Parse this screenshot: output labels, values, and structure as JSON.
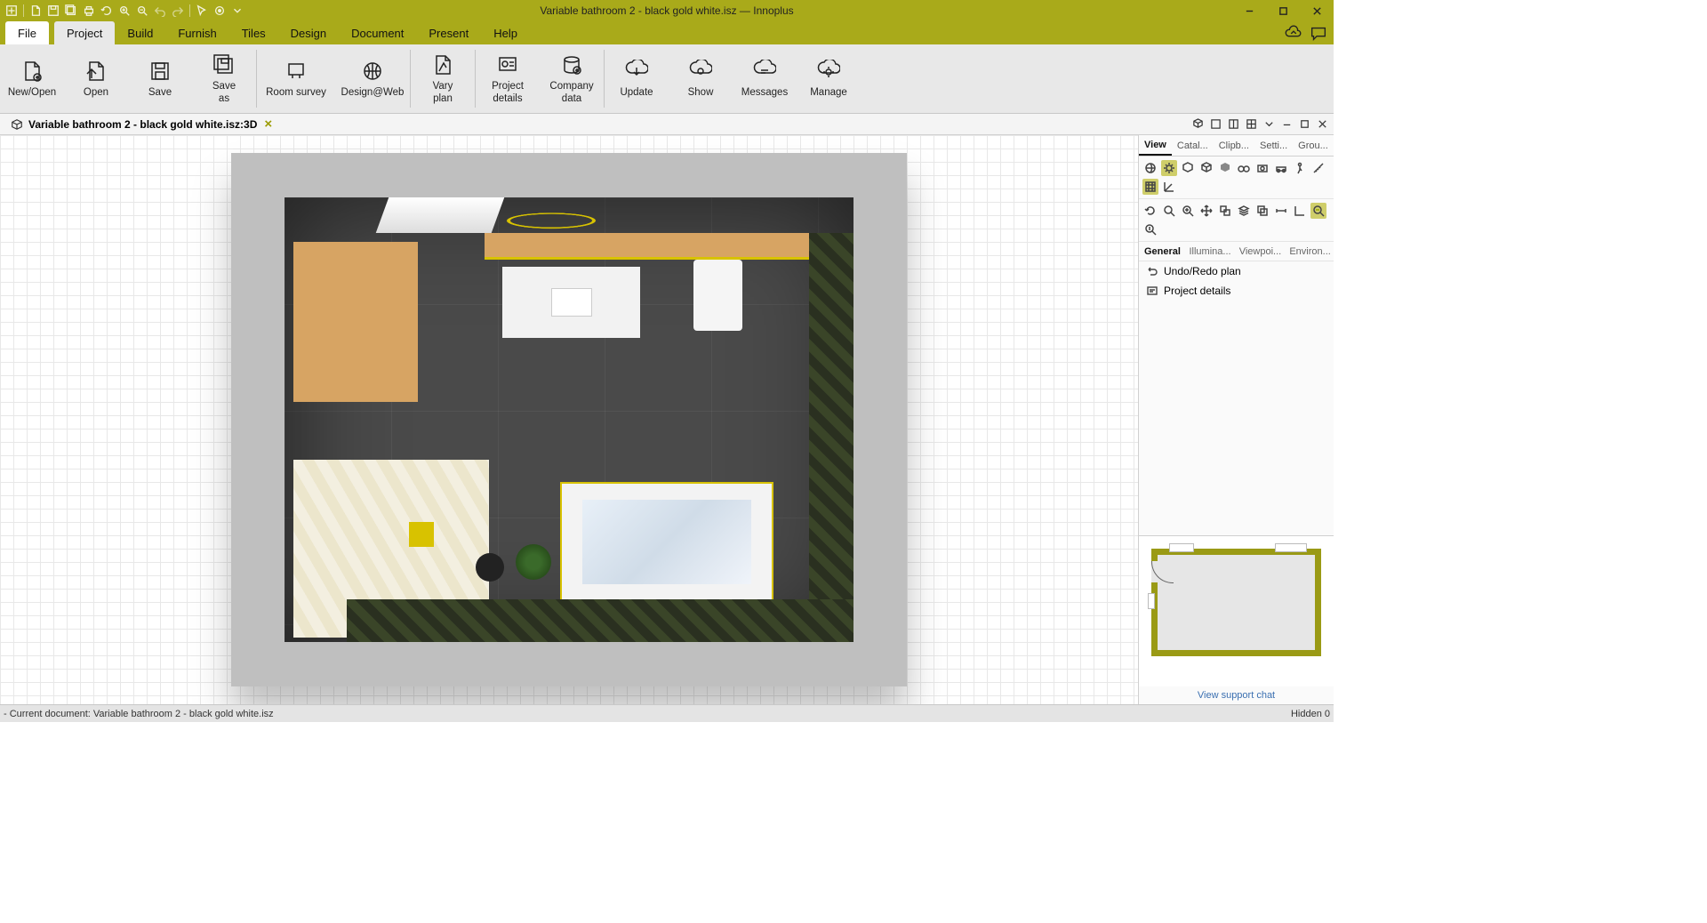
{
  "app": {
    "title": "Variable bathroom 2 - black gold white.isz — Innoplus"
  },
  "menu": {
    "file": "File",
    "tabs": [
      "Project",
      "Build",
      "Furnish",
      "Tiles",
      "Design",
      "Document",
      "Present",
      "Help"
    ],
    "active": "Project"
  },
  "ribbon": [
    {
      "id": "new-open",
      "label": "New/Open"
    },
    {
      "id": "open",
      "label": "Open"
    },
    {
      "id": "save",
      "label": "Save"
    },
    {
      "id": "save-as",
      "label": "Save\nas"
    },
    {
      "sep": true
    },
    {
      "id": "room-survey",
      "label": "Room survey"
    },
    {
      "id": "design-web",
      "label": "Design@Web"
    },
    {
      "sep": true
    },
    {
      "id": "vary-plan",
      "label": "Vary\nplan"
    },
    {
      "sep": true
    },
    {
      "id": "project-details",
      "label": "Project\ndetails"
    },
    {
      "id": "company-data",
      "label": "Company\ndata"
    },
    {
      "sep": true
    },
    {
      "id": "update",
      "label": "Update"
    },
    {
      "id": "show",
      "label": "Show"
    },
    {
      "id": "messages",
      "label": "Messages"
    },
    {
      "id": "manage",
      "label": "Manage"
    }
  ],
  "document_tab": "Variable bathroom 2 - black gold white.isz:3D",
  "right_panel": {
    "tabs": [
      "View",
      "Catal...",
      "Clipb...",
      "Setti...",
      "Grou..."
    ],
    "active_tab": "View",
    "sub_tabs": [
      "General",
      "Illumina...",
      "Viewpoi...",
      "Environ..."
    ],
    "active_sub": "General",
    "items": [
      {
        "id": "undo-redo-plan",
        "label": "Undo/Redo plan"
      },
      {
        "id": "project-details",
        "label": "Project details"
      }
    ],
    "support": "View support chat"
  },
  "status": {
    "left": "- Current document: Variable bathroom 2 - black gold white.isz",
    "right": "Hidden 0"
  }
}
